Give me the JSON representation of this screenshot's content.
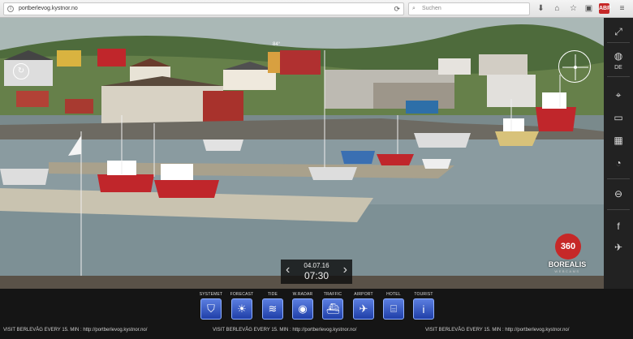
{
  "browser": {
    "url": "portberlevog.kystnor.no",
    "search_placeholder": "Suchen",
    "addon_badge": "ABP"
  },
  "webcam": {
    "heading_label": "84°",
    "date": "04.07.16",
    "time": "07:30",
    "prev_icon": "chevron-left-icon",
    "next_icon": "chevron-right-icon"
  },
  "right_rail": {
    "language": "DE",
    "items": [
      "fullscreen-icon",
      "globe-icon",
      "map-pin-icon",
      "camera-icon",
      "gallery-icon",
      "timelapse-icon",
      "video-icon",
      "facebook-icon",
      "twitter-icon"
    ]
  },
  "logo": {
    "badge": "360",
    "name": "BOREALIS",
    "subtitle": "WEBCAMS"
  },
  "nav": [
    {
      "label": "SYSTEMET",
      "icon": "shield-icon"
    },
    {
      "label": "FORECAST",
      "icon": "weather-icon"
    },
    {
      "label": "TIDE",
      "icon": "waves-icon"
    },
    {
      "label": "W.RADAR",
      "icon": "radar-icon"
    },
    {
      "label": "TRAFFIC",
      "icon": "ship-icon"
    },
    {
      "label": "AIRPORT",
      "icon": "plane-icon"
    },
    {
      "label": "HOTEL",
      "icon": "bed-icon"
    },
    {
      "label": "TOURIST",
      "icon": "info-icon"
    }
  ],
  "ticker": "VISIT BERLEVÅG EVERY 15. MIN : http://portberlevog.kystnor.no/",
  "colors": {
    "sky": "#b7c4c6",
    "water": "#8a9ba0",
    "boat_red": "#c0262b",
    "nav_blue": "#2d56c8"
  }
}
